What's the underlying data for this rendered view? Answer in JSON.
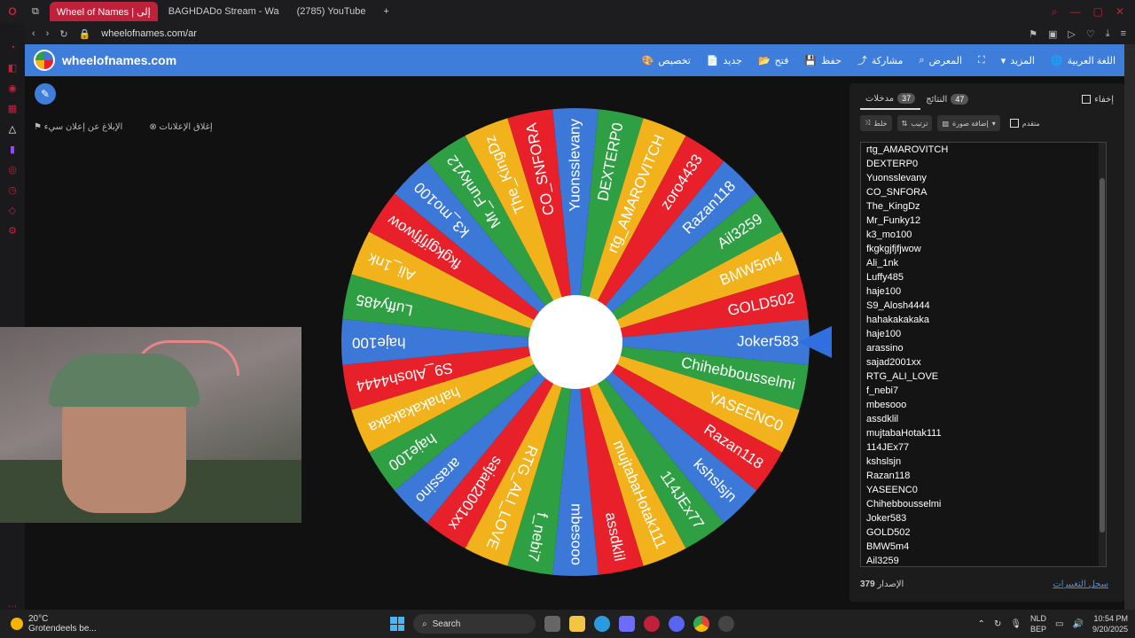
{
  "browser": {
    "tabs": [
      {
        "label": "Wheel of Names | إلى",
        "active": true
      },
      {
        "label": "BAGHDADo Stream - Wa",
        "active": false
      },
      {
        "label": "(2785) YouTube",
        "active": false
      }
    ],
    "url": "wheelofnames.com/ar"
  },
  "app": {
    "brand": "wheelofnames.com",
    "menu": [
      "اللغة العربية",
      "المزيد",
      "المعرض",
      "مشاركة",
      "حفظ",
      "فتح",
      "جديد",
      "تخصيص"
    ]
  },
  "ads": {
    "report": "الإبلاغ عن إعلان سيء",
    "close": "إغلاق الإعلانات"
  },
  "wheel": {
    "entries": [
      "Yuonsslevany",
      "DEXTERP0",
      "rtg_AMAROVITCH",
      "zoro4433",
      "Razan118",
      "Ail3259",
      "BMW5m4",
      "GOLD502",
      "Joker583",
      "Chihebbousselmi",
      "YASEENC0",
      "Razan118",
      "kshslsjn",
      "114JEx77",
      "mujtabaHotak111",
      "assdklil",
      "mbesooo",
      "f_nebi7",
      "RTG_ALI_LOVE",
      "sajad2001xx",
      "arassino",
      "haje100",
      "hahakakakaka",
      "S9_Alosh4444",
      "haje100",
      "Luffy485",
      "Ali_1nk",
      "fkgkgjfjfjwow",
      "k3_mo100",
      "Mr_Funky12",
      "The_KingDz",
      "CO_SNFORA"
    ],
    "colors": [
      "#3c78d8",
      "#2ea043",
      "#f1b21c",
      "#e8202a"
    ]
  },
  "panel": {
    "tab_entries": "مدخلات",
    "entries_count": "37",
    "tab_results": "النتائج",
    "results_count": "47",
    "hide": "إخفاء",
    "shuffle": "خلط",
    "sort": "ترتيب",
    "add_image": "إضافة صورة",
    "advanced": "متقدم",
    "list": [
      "rtg_AMAROVITCH",
      "DEXTERP0",
      "Yuonsslevany",
      "CO_SNFORA",
      "The_KingDz",
      "Mr_Funky12",
      "k3_mo100",
      "fkgkgjfjfjwow",
      "Ali_1nk",
      "Luffy485",
      "haje100",
      "S9_Alosh4444",
      "hahakakakaka",
      "haje100",
      "arassino",
      "sajad2001xx",
      "RTG_ALI_LOVE",
      "f_nebi7",
      "mbesooo",
      "assdklil",
      "mujtabaHotak111",
      "114JEx77",
      "kshslsjn",
      "Razan118",
      "YASEENC0",
      "Chihebbousselmi",
      "Joker583",
      "GOLD502",
      "BMW5m4",
      "Ail3259"
    ],
    "version_label": "الإصدار",
    "version": "379",
    "changelog": "سجل التغييرات"
  },
  "taskbar": {
    "temp": "20°C",
    "weather": "Grotendeels be...",
    "search": "Search",
    "lang1": "NLD",
    "lang2": "BEP",
    "time": "10:54 PM",
    "date": "9/20/2025"
  }
}
